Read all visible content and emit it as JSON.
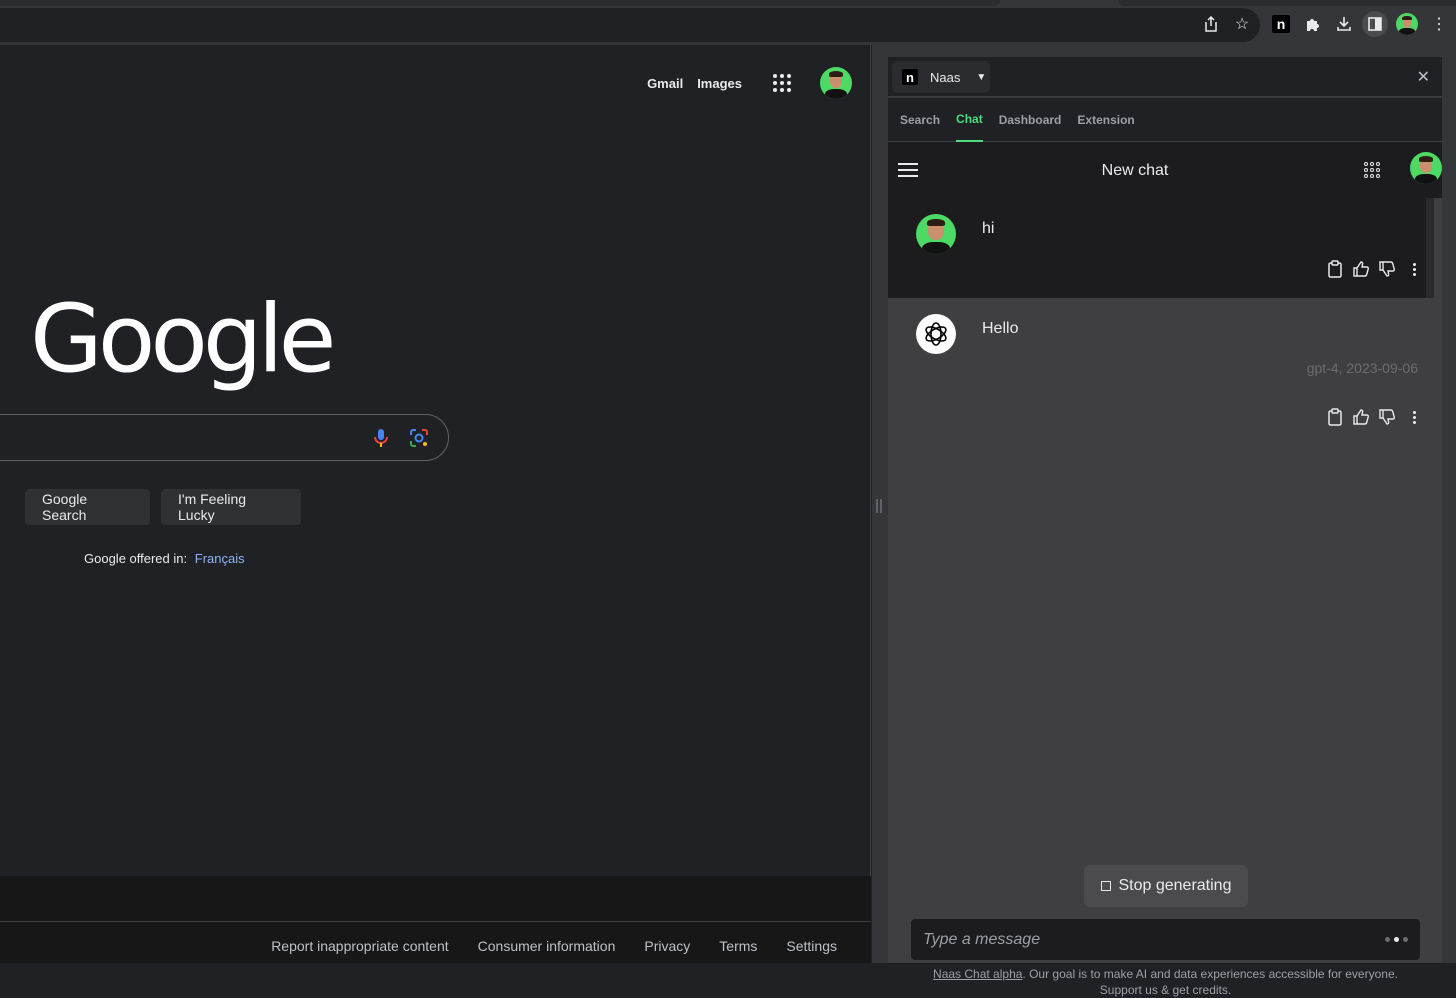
{
  "browser": {
    "toolbar_icons": [
      "share-icon",
      "star-icon",
      "naas-extension-icon",
      "puzzle-icon",
      "download-icon",
      "side-panel-icon",
      "profile-avatar",
      "more-vert-icon"
    ],
    "naas_glyph": "n"
  },
  "google": {
    "top_links": {
      "gmail": "Gmail",
      "images": "Images"
    },
    "logo": "Google",
    "buttons": {
      "search": "Google Search",
      "lucky": "I'm Feeling Lucky"
    },
    "offered_in": {
      "label": "Google offered in:",
      "language": "Français"
    },
    "footer_links": [
      "Report inappropriate content",
      "Consumer information",
      "Privacy",
      "Terms",
      "Settings"
    ]
  },
  "sidepanel": {
    "extension_name": "Naas",
    "extension_glyph": "n",
    "tabs": [
      {
        "label": "Search",
        "active": false
      },
      {
        "label": "Chat",
        "active": true
      },
      {
        "label": "Dashboard",
        "active": false
      },
      {
        "label": "Extension",
        "active": false
      }
    ],
    "chat": {
      "title": "New chat",
      "messages": [
        {
          "role": "user",
          "text": "hi"
        },
        {
          "role": "assistant",
          "text": "Hello",
          "meta": "gpt-4, 2023-09-06"
        }
      ],
      "stop_label": "Stop generating",
      "input_placeholder": "Type a message",
      "disclaimer_link": "Naas Chat alpha",
      "disclaimer_text": ". Our goal is to make AI and data experiences accessible for everyone. Support us & get credits."
    },
    "colors": {
      "accent": "#4ade80",
      "link": "#8ab4f8"
    }
  }
}
